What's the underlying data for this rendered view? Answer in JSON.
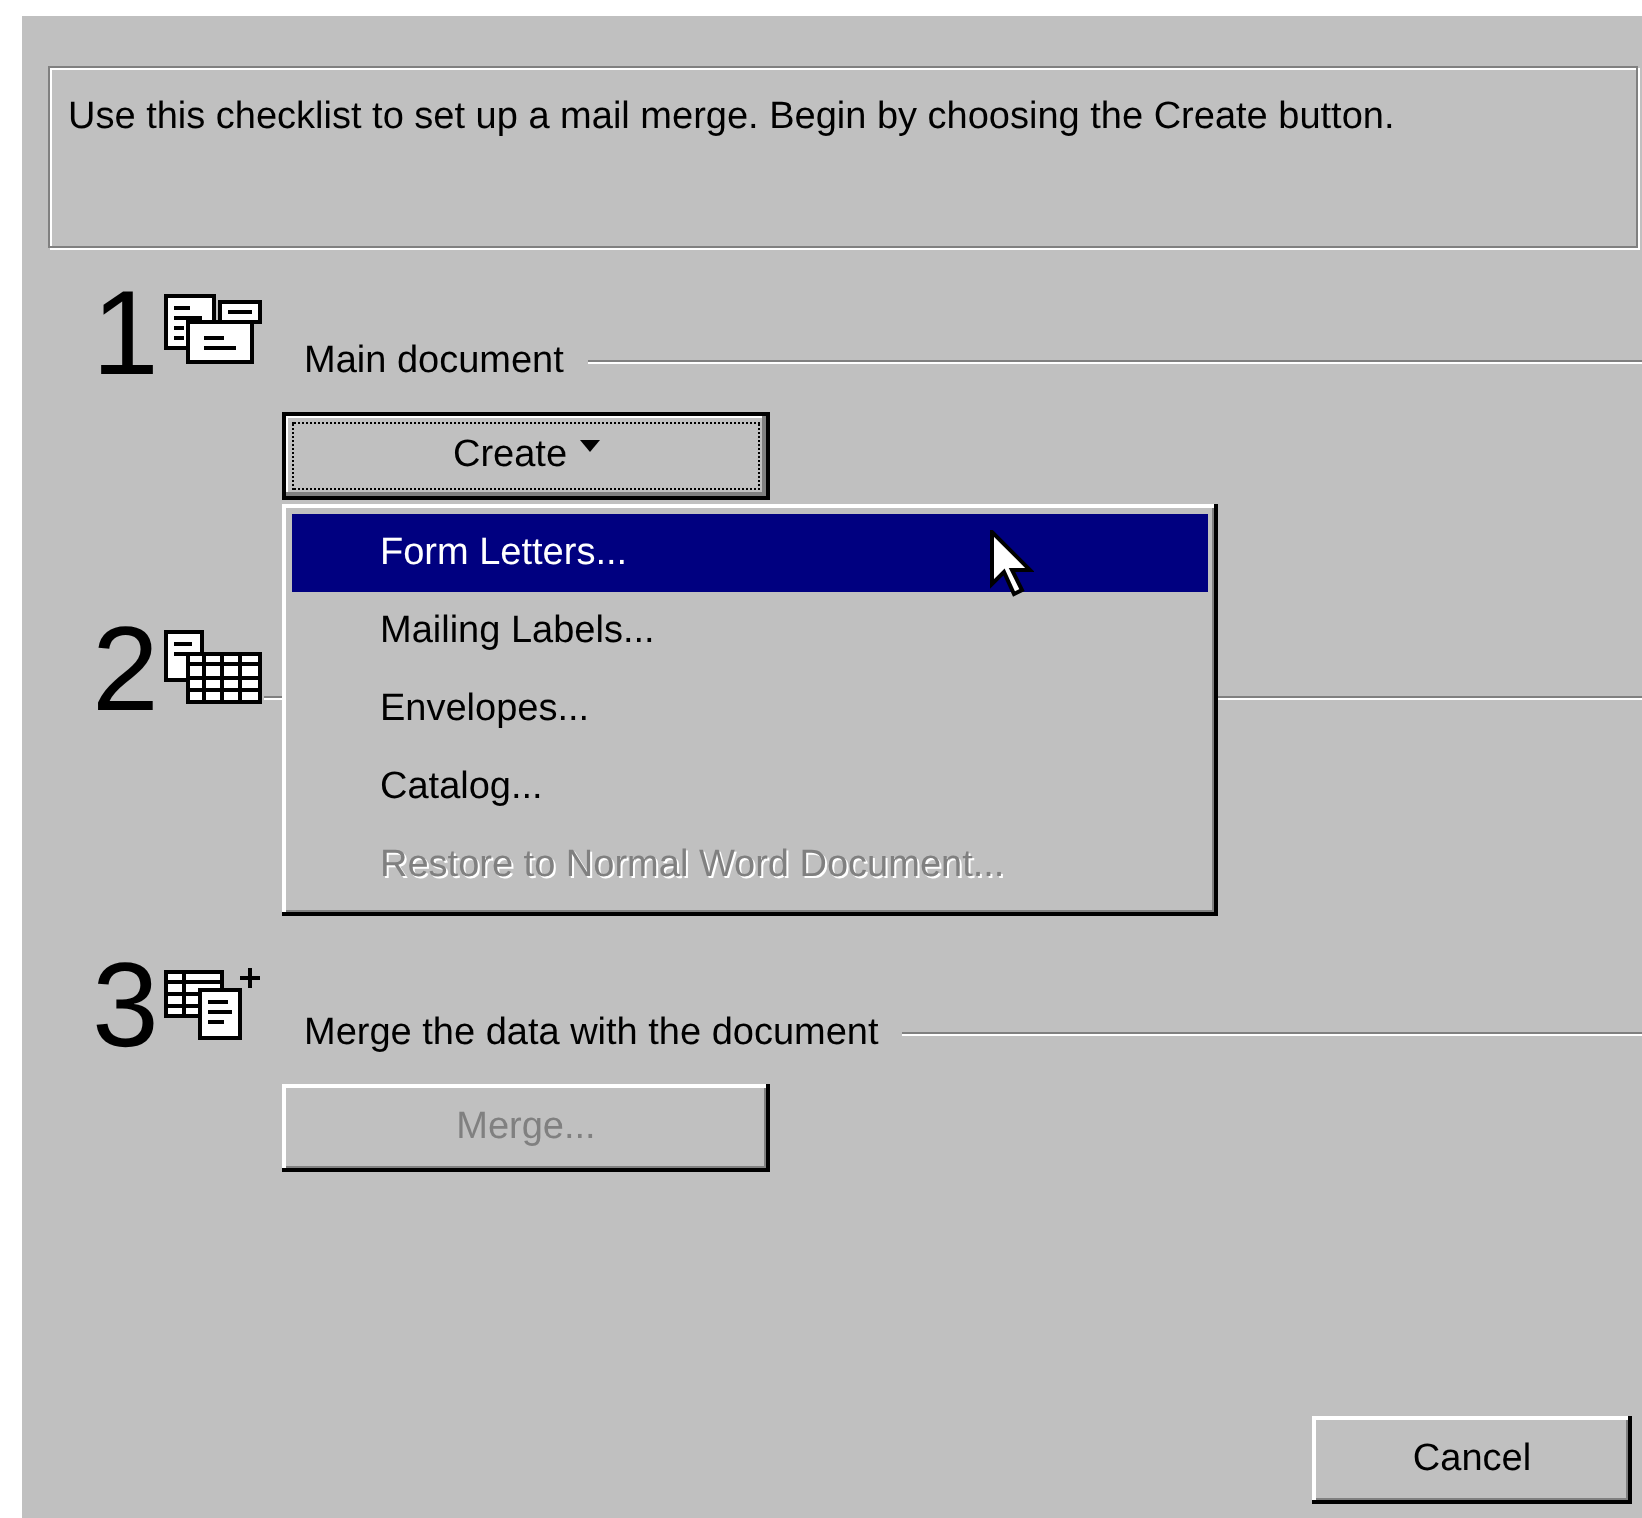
{
  "intro": "Use this checklist to set up a mail merge. Begin by choosing the Create button.",
  "steps": [
    {
      "number": "1",
      "kind": "document",
      "heading": "Main document",
      "button": {
        "label": "Create",
        "disabled": false,
        "focused": true,
        "dropdown": true
      }
    },
    {
      "number": "2",
      "kind": "data"
    },
    {
      "number": "3",
      "kind": "merge",
      "heading": "Merge the data with the document",
      "button": {
        "label": "Merge...",
        "disabled": true,
        "focused": false,
        "dropdown": false
      }
    }
  ],
  "menu": {
    "items": [
      {
        "label": "Form Letters...",
        "selected": true,
        "disabled": false
      },
      {
        "label": "Mailing Labels...",
        "selected": false,
        "disabled": false
      },
      {
        "label": "Envelopes...",
        "selected": false,
        "disabled": false
      },
      {
        "label": "Catalog...",
        "selected": false,
        "disabled": false
      },
      {
        "label": "Restore to Normal Word Document...",
        "selected": false,
        "disabled": true
      }
    ]
  },
  "cancel_button": "Cancel"
}
